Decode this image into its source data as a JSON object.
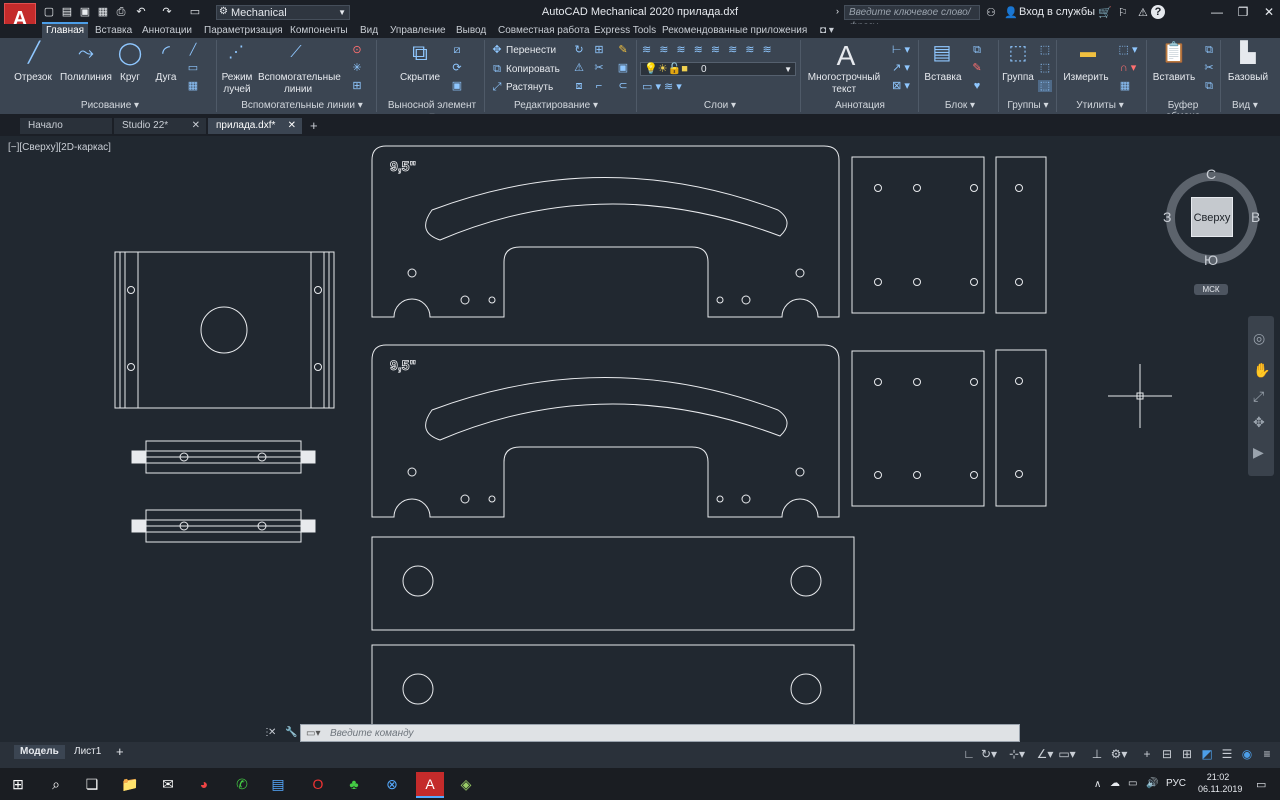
{
  "app": {
    "logo_letter": "A",
    "logo_sub": "M",
    "window_title": "AutoCAD Mechanical 2020   прилада.dxf",
    "workspace": "Mechanical",
    "search_placeholder": "Введите ключевое слово/фразу",
    "signin_label": "Вход в службы",
    "help_label": "?"
  },
  "ribbon_tabs": [
    {
      "label": "Главная",
      "active": true
    },
    {
      "label": "Вставка"
    },
    {
      "label": "Аннотации"
    },
    {
      "label": "Параметризация"
    },
    {
      "label": "Компоненты"
    },
    {
      "label": "Вид"
    },
    {
      "label": "Управление"
    },
    {
      "label": "Вывод"
    },
    {
      "label": "Совместная работа"
    },
    {
      "label": "Express Tools"
    },
    {
      "label": "Рекомендованные приложения"
    }
  ],
  "ribbon": {
    "draw": {
      "line": "Отрезок",
      "polyline": "Полилиния",
      "circle": "Круг",
      "arc": "Дуга",
      "title": "Рисование"
    },
    "construction": {
      "ray_mode": "Режим\nлучей",
      "aux_lines": "Вспомогательные\nлинии",
      "title": "Вспомогательные линии"
    },
    "detail": {
      "hide": "Скрытие",
      "title": "Выносной элемент"
    },
    "modify": {
      "move": "Перенести",
      "copy": "Копировать",
      "stretch": "Растянуть",
      "title": "Редактирование"
    },
    "layers": {
      "layer_value": "0",
      "title": "Слои"
    },
    "annotation": {
      "mtext": "Многострочный\nтекст",
      "title": "Аннотация"
    },
    "block": {
      "insert": "Вставка",
      "title": "Блок"
    },
    "groups": {
      "group": "Группа",
      "title": "Группы"
    },
    "utilities": {
      "measure": "Измерить",
      "title": "Утилиты"
    },
    "clipboard": {
      "paste": "Вставить",
      "title": "Буфер обмена"
    },
    "view": {
      "base": "Базовый",
      "title": "Вид"
    }
  },
  "file_tabs": [
    {
      "label": "Начало"
    },
    {
      "label": "Studio 22*"
    },
    {
      "label": "прилада.dxf*",
      "active": true
    }
  ],
  "viewport": {
    "label": "[−][Сверху][2D-каркас]",
    "cube_face": "Сверху",
    "north": "С",
    "south": "Ю",
    "east": "В",
    "west": "З",
    "wcs": "МСК"
  },
  "drawing": {
    "mark_top": "9,5\"",
    "mark_bottom": "9,5\""
  },
  "command": {
    "placeholder": "Введите команду"
  },
  "layout_tabs": [
    {
      "label": "Модель",
      "active": true
    },
    {
      "label": "Лист1"
    }
  ],
  "taskbar": {
    "lang": "РУС",
    "time": "21:02",
    "date": "06.11.2019"
  },
  "colors": {
    "accent": "#4c9ee8",
    "drawing_bg": "#212830",
    "ribbon_bg": "#3b4552"
  }
}
